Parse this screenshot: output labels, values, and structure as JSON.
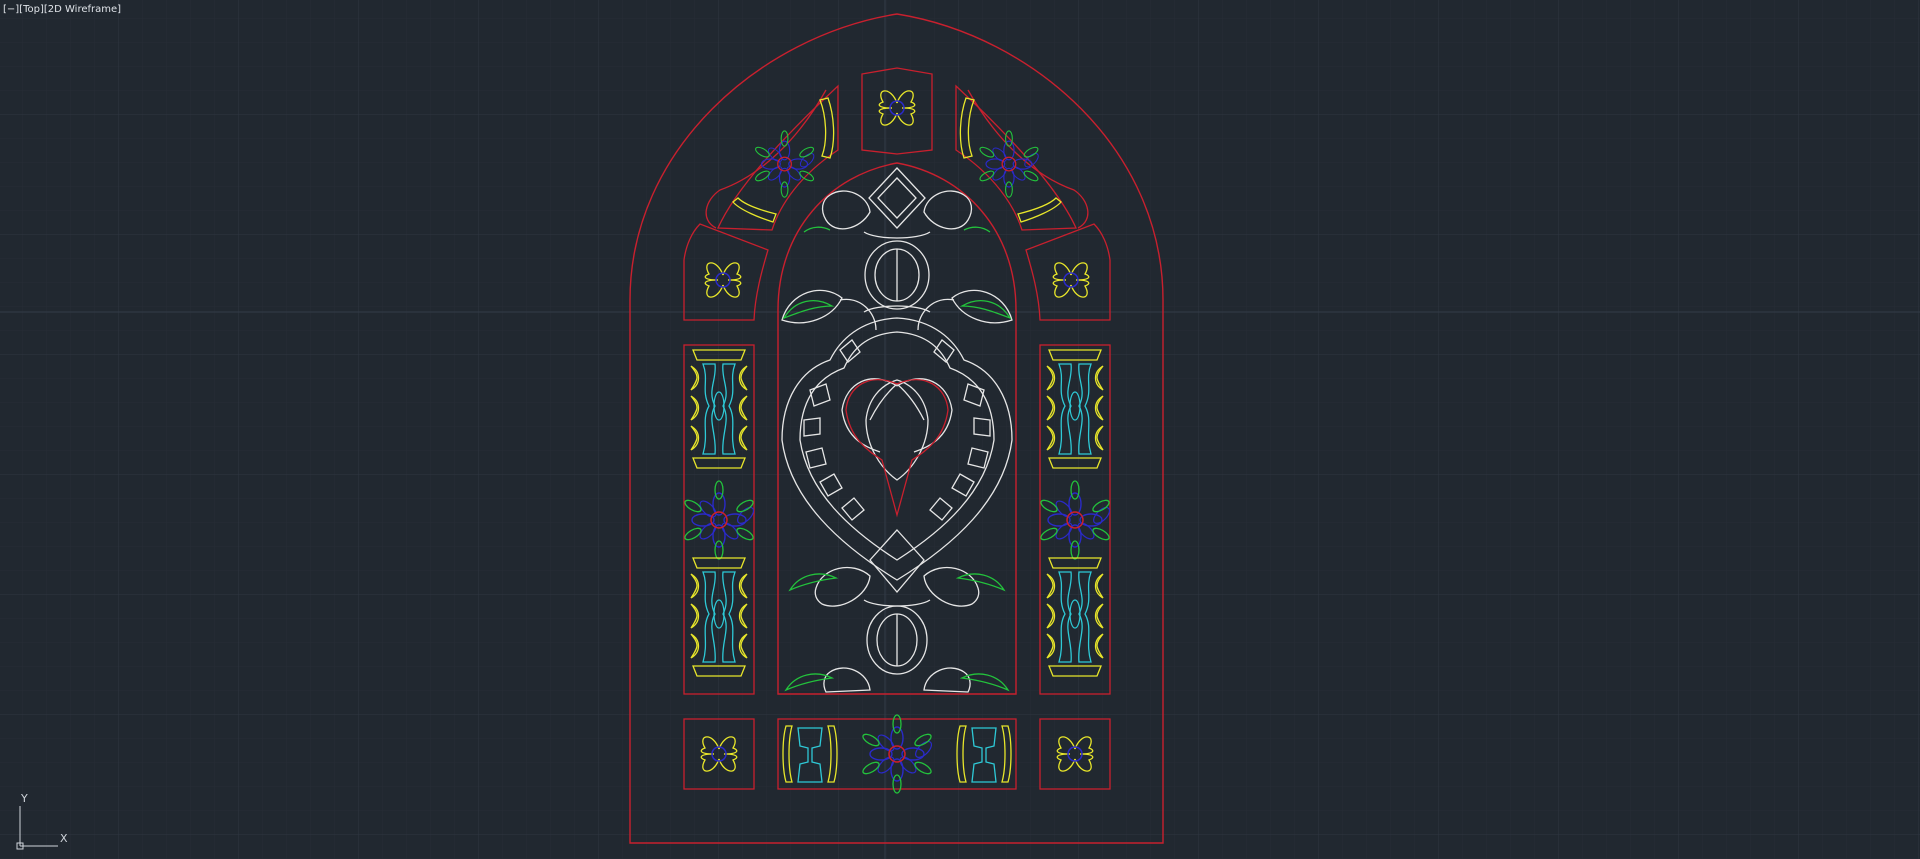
{
  "viewport": {
    "label": "[−][Top][2D Wireframe]",
    "background": "#212830",
    "grid_major": "#2d3540",
    "grid_minor": "#262d36"
  },
  "ucs": {
    "x_label": "X",
    "y_label": "Y",
    "color": "#cfd4da"
  },
  "drawing": {
    "subject": "stained-glass-arched-window",
    "colors": {
      "frame": "#c8202e",
      "lead": "#e6e6e6",
      "yellow": "#e8e62a",
      "green": "#23c23c",
      "blue": "#2a2ac8",
      "cyan": "#2ec9d6",
      "red": "#d0202a"
    }
  }
}
